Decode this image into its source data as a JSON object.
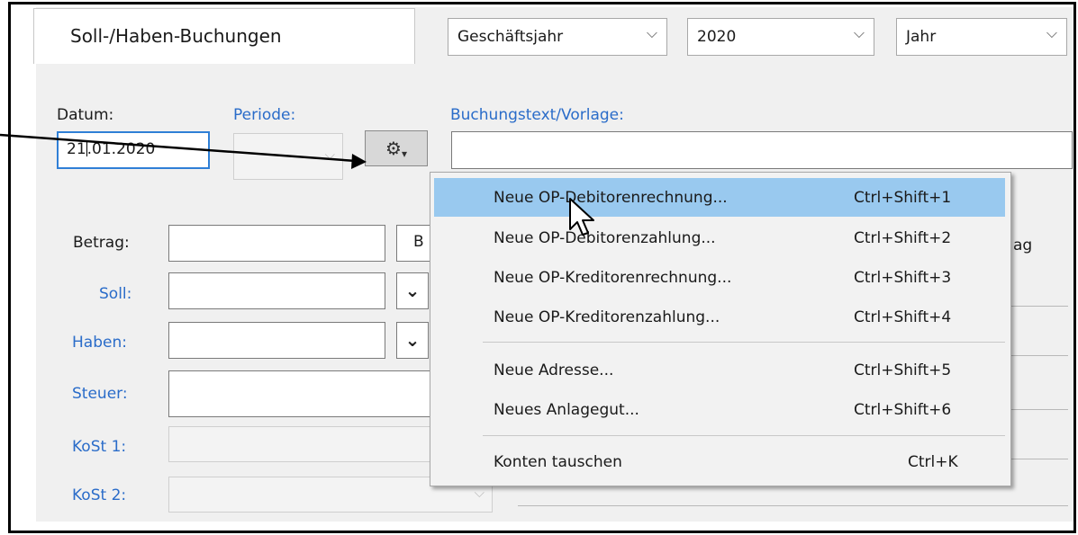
{
  "tab": {
    "label": "Soll-/Haben-Buchungen"
  },
  "filters": {
    "period_type": "Geschäftsjahr",
    "year": "2020",
    "unit": "Jahr"
  },
  "form": {
    "date_label": "Datum:",
    "date_value_before": "21",
    "date_value_after": ".01.2020",
    "periode_label": "Periode:",
    "text_label": "Buchungstext/Vorlage:",
    "betrag_label": "Betrag:",
    "betrag_suffix": "B",
    "partial_label": "ag",
    "soll_label": "Soll:",
    "haben_label": "Haben:",
    "steuer_label": "Steuer:",
    "kost1_label": "KoSt 1:",
    "kost2_label": "KoSt 2:"
  },
  "icons": {
    "gear": "gear-icon",
    "caret": "caret-down-icon",
    "chevron": "chevron-down-icon",
    "cursor": "mouse-cursor-icon",
    "callout": "callout-arrow"
  },
  "colors": {
    "blue_label": "#2a6cc9",
    "menu_highlight": "#99c9ef",
    "focus_border": "#2f7fd6"
  },
  "menu": {
    "items": [
      {
        "label": "Neue OP-Debitorenrechnung...",
        "shortcut": "Ctrl+Shift+1"
      },
      {
        "label": "Neue OP-Debitorenzahlung...",
        "shortcut": "Ctrl+Shift+2"
      },
      {
        "label": "Neue OP-Kreditorenrechnung...",
        "shortcut": "Ctrl+Shift+3"
      },
      {
        "label": "Neue OP-Kreditorenzahlung...",
        "shortcut": "Ctrl+Shift+4"
      },
      {
        "label": "Neue Adresse...",
        "shortcut": "Ctrl+Shift+5"
      },
      {
        "label": "Neues Anlagegut...",
        "shortcut": "Ctrl+Shift+6"
      },
      {
        "label": "Konten tauschen",
        "shortcut": "Ctrl+K"
      }
    ]
  }
}
